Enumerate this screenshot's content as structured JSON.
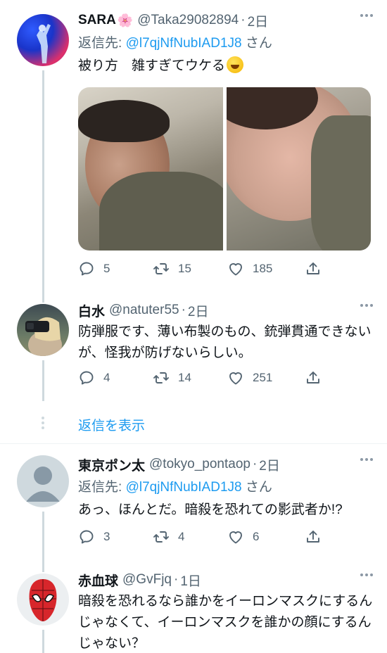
{
  "tweets": [
    {
      "name": "SARA",
      "name_emoji": "🌸",
      "handle": "@Taka29082894",
      "time": "2日",
      "reply_prefix": "返信先: ",
      "reply_mention": "@l7qjNfNubIAD1J8",
      "reply_suffix": " さん",
      "text": "被り方　雑すぎてウケる",
      "replies": "5",
      "retweets": "15",
      "likes": "185"
    },
    {
      "name": "白水",
      "handle": "@natuter55",
      "time": "2日",
      "text": "防弾服です、薄い布製のもの、銃弾貫通できないが、怪我が防げないらしい。",
      "replies": "4",
      "retweets": "14",
      "likes": "251"
    },
    {
      "name": "東京ポン太",
      "handle": "@tokyo_pontaop",
      "time": "2日",
      "reply_prefix": "返信先: ",
      "reply_mention": "@l7qjNfNubIAD1J8",
      "reply_suffix": " さん",
      "text": "あっ、ほんとだ。暗殺を恐れての影武者か!?",
      "replies": "3",
      "retweets": "4",
      "likes": "6"
    },
    {
      "name": "赤血球",
      "handle": "@GvFjq",
      "time": "1日",
      "text": "暗殺を恐れるなら誰かをイーロンマスクにするんじゃなくて、イーロンマスクを誰かの顔にするんじゃない？"
    }
  ],
  "show_replies_label": "返信を表示",
  "dot_separator": "·",
  "colors": {
    "link": "#1d9bf0",
    "muted": "#536471",
    "line": "#cfd9de"
  }
}
